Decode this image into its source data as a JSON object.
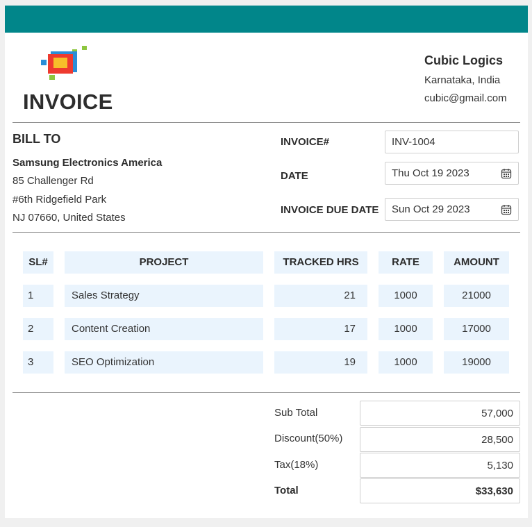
{
  "brand": {
    "bar_color": "#01868a",
    "logo_icon": "stacked-squares-logo"
  },
  "invoice": {
    "title": "INVOICE"
  },
  "company": {
    "name": "Cubic Logics",
    "location": "Karnataka, India",
    "email": "cubic@gmail.com"
  },
  "bill_to": {
    "heading": "BILL TO",
    "name": "Samsung Electronics America",
    "address": [
      "85 Challenger Rd",
      "#6th Ridgefield Park",
      "NJ 07660, United States"
    ]
  },
  "meta": {
    "invoice_no_label": "INVOICE#",
    "invoice_no": "INV-1004",
    "date_label": "DATE",
    "date": "Thu Oct 19 2023",
    "due_label": "INVOICE DUE DATE",
    "due_date": "Sun Oct 29 2023",
    "calendar_icon": "calendar-icon"
  },
  "table": {
    "headers": [
      "SL#",
      "PROJECT",
      "TRACKED HRS",
      "RATE",
      "AMOUNT"
    ],
    "rows": [
      {
        "sl": "1",
        "project": "Sales Strategy",
        "hrs": "21",
        "rate": "1000",
        "amount": "21000"
      },
      {
        "sl": "2",
        "project": "Content Creation",
        "hrs": "17",
        "rate": "1000",
        "amount": "17000"
      },
      {
        "sl": "3",
        "project": "SEO Optimization",
        "hrs": "19",
        "rate": "1000",
        "amount": "19000"
      }
    ]
  },
  "summary": {
    "subtotal_label": "Sub Total",
    "subtotal": "57,000",
    "discount_label": "Discount(50%)",
    "discount": "28,500",
    "tax_label": "Tax(18%)",
    "tax": "5,130",
    "total_label": "Total",
    "total": "$33,630"
  }
}
